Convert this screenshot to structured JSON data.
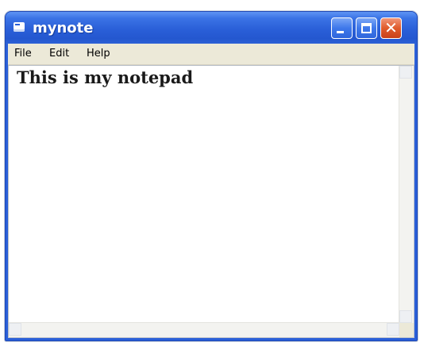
{
  "window": {
    "title": "mynote",
    "controls": {
      "minimize_icon": "minimize-icon",
      "maximize_icon": "maximize-icon",
      "close_icon": "close-icon",
      "close_glyph": "✕"
    }
  },
  "menubar": {
    "items": [
      {
        "label": "File"
      },
      {
        "label": "Edit"
      },
      {
        "label": "Help"
      }
    ]
  },
  "editor": {
    "content": "This is my notepad"
  },
  "colors": {
    "titlebar": "#2a5fd8",
    "close_button": "#e05b2c",
    "menubar": "#ece9d8",
    "client": "#ffffff"
  }
}
